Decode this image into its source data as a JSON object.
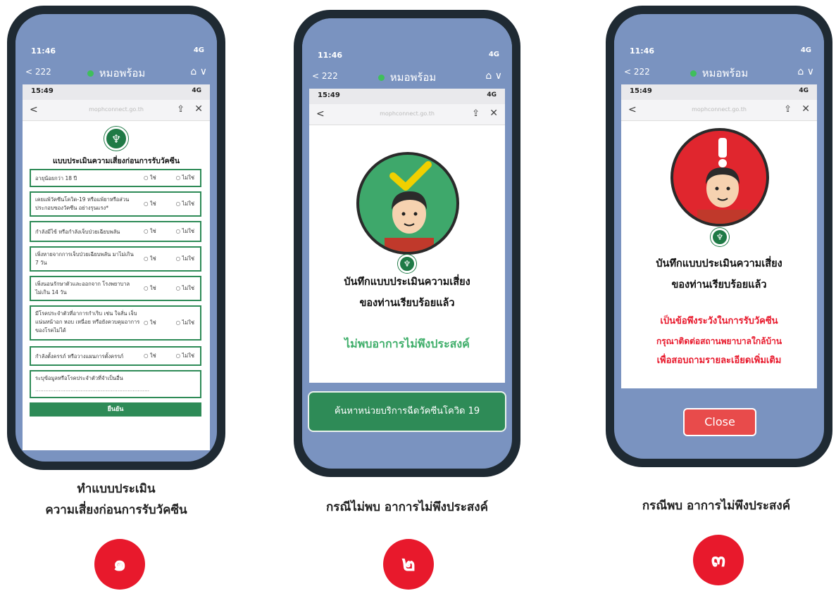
{
  "phones": [
    {
      "status_time": "11:46",
      "status_signal": "4G",
      "nav_back": "< 222",
      "nav_title": "หมอพร้อม",
      "web_time": "15:49",
      "web_signal": "4G",
      "web_url": "mophconnect.go.th",
      "form_title": "แบบประเมินความเสี่ยงก่อนการรับวัคซีน",
      "questions": [
        {
          "text": "อายุน้อยกว่า 18 ปี",
          "yes": "○ ใช่",
          "no": "○ ไม่ใช่"
        },
        {
          "text": "เคยแพ้วัคซีนโควิด-19 หรือแพ้ยาหรือส่วนประกอบของวัคซีน อย่างรุนแรง*",
          "yes": "○ ใช่",
          "no": "○ ไม่ใช่"
        },
        {
          "text": "กำลังมีไข้ หรือกำลังเจ็บป่วยเฉียบพลัน",
          "yes": "○ ใช่",
          "no": "○ ไม่ใช่"
        },
        {
          "text": "เพิ่งหายจากการเจ็บป่วยเฉียบพลัน มาไม่เกิน 7 วัน",
          "yes": "○ ใช่",
          "no": "○ ไม่ใช่"
        },
        {
          "text": "เพิ่งนอนรักษาตัวและออกจาก โรงพยาบาลไม่เกิน 14 วัน",
          "yes": "○ ใช่",
          "no": "○ ไม่ใช่"
        },
        {
          "text": "มีโรคประจำตัวที่อาการกำเริบ เช่น ใจสั่น เจ็บแน่นหน้าอก หอบ เหนื่อย หรือยังควบคุมอาการของโรคไม่ได้",
          "yes": "○ ใช่",
          "no": "○ ไม่ใช่"
        },
        {
          "text": "กำลังตั้งครรภ์ หรือวางแผนการตั้งครรภ์",
          "yes": "○ ใช่",
          "no": "○ ไม่ใช่"
        }
      ],
      "note_label": "ระบุข้อมูลหรือโรคประจำตัวที่จำเป็นอื่น",
      "note_dots": "....................................................................",
      "confirm_label": "ยืนยัน"
    },
    {
      "status_time": "11:46",
      "status_signal": "4G",
      "nav_back": "< 222",
      "nav_title": "หมอพร้อม",
      "web_time": "15:49",
      "web_signal": "4G",
      "web_url": "mophconnect.go.th",
      "result_title_1": "บันทึกแบบประเมินความเสี่ยง",
      "result_title_2": "ของท่านเรียบร้อยแล้ว",
      "result_status": "ไม่พบอาการไม่พึงประสงค์",
      "action_button": "ค้นหาหน่วยบริการฉีดวัคซีนโควิด 19"
    },
    {
      "status_time": "11:46",
      "status_signal": "4G",
      "nav_back": "< 222",
      "nav_title": "หมอพร้อม",
      "web_time": "15:49",
      "web_signal": "4G",
      "web_url": "mophconnect.go.th",
      "result_title_1": "บันทึกแบบประเมินความเสี่ยง",
      "result_title_2": "ของท่านเรียบร้อยแล้ว",
      "warning_1": "เป็นข้อพึงระวังในการรับวัคซีน",
      "warning_2": "กรุณาติดต่อสถานพยาบาลใกล้บ้าน",
      "warning_3": "เพื่อสอบถามรายละเอียดเพิ่มเติม",
      "close_button": "Close"
    }
  ],
  "captions": [
    {
      "line1": "ทำแบบประเมิน",
      "line2": "ความเสี่ยงก่อนการรับวัคซีน",
      "badge": "๑"
    },
    {
      "line1": "กรณีไม่พบ อาการไม่พึงประสงค์",
      "badge": "๒"
    },
    {
      "line1": "กรณีพบ อาการไม่พึงประสงค์",
      "badge": "๓"
    }
  ],
  "colors": {
    "accent_green": "#2e8b57",
    "alert_red": "#e8192c",
    "phone_blue": "#7a93c0"
  }
}
